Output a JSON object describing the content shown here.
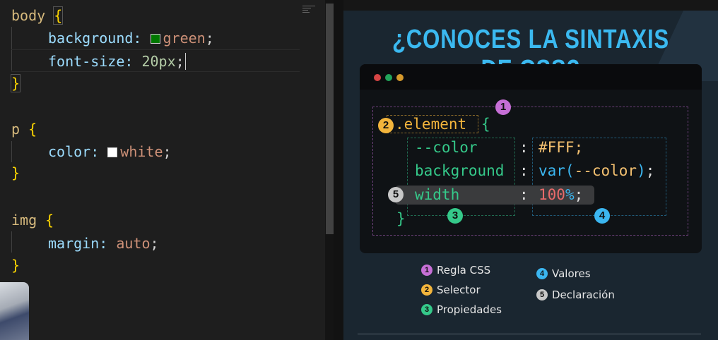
{
  "editor": {
    "lines": {
      "l1_sel": "body",
      "l1_br": "{",
      "l2_prop": "background:",
      "l2_val": "green",
      "l2_end": ";",
      "l3_prop": "font-size:",
      "l3_val": "20px",
      "l3_end": ";",
      "l4_br": "}",
      "l5_sel": "p",
      "l5_br": "{",
      "l6_prop": "color:",
      "l6_val": "white",
      "l6_end": ";",
      "l7_br": "}",
      "l8_sel": "img",
      "l8_br": "{",
      "l9_prop": "margin:",
      "l9_val": "auto",
      "l9_end": ";",
      "l10_br": "}"
    },
    "swatches": {
      "green": "#007800",
      "white": "#ffffff"
    }
  },
  "infographic": {
    "title": "¿CONOCES LA SINTAXIS DE CSS?",
    "window_dots": [
      "#d64545",
      "#22a45a",
      "#d69a2c"
    ],
    "code": {
      "selector": ".element",
      "open": "{",
      "p1": "--color",
      "p2": "background",
      "p3": "width",
      "colon": ":",
      "v1": "#FFF;",
      "v2a": "var(",
      "v2b": "--color",
      "v2c": ")",
      "v2d": ";",
      "v3a": "100",
      "v3b": "%",
      "v3c": ";",
      "close": "}"
    },
    "badges": {
      "b1": "1",
      "b2": "2",
      "b3": "3",
      "b4": "4",
      "b5": "5"
    },
    "legend": [
      {
        "num": "1",
        "label": "Regla CSS",
        "color": "#c66fd6"
      },
      {
        "num": "2",
        "label": "Selector",
        "color": "#f3b53c"
      },
      {
        "num": "3",
        "label": "Propiedades",
        "color": "#35c98a"
      },
      {
        "num": "4",
        "label": "Valores",
        "color": "#3bb6f0"
      },
      {
        "num": "5",
        "label": "Declaración",
        "color": "#c8c8c8"
      }
    ]
  }
}
